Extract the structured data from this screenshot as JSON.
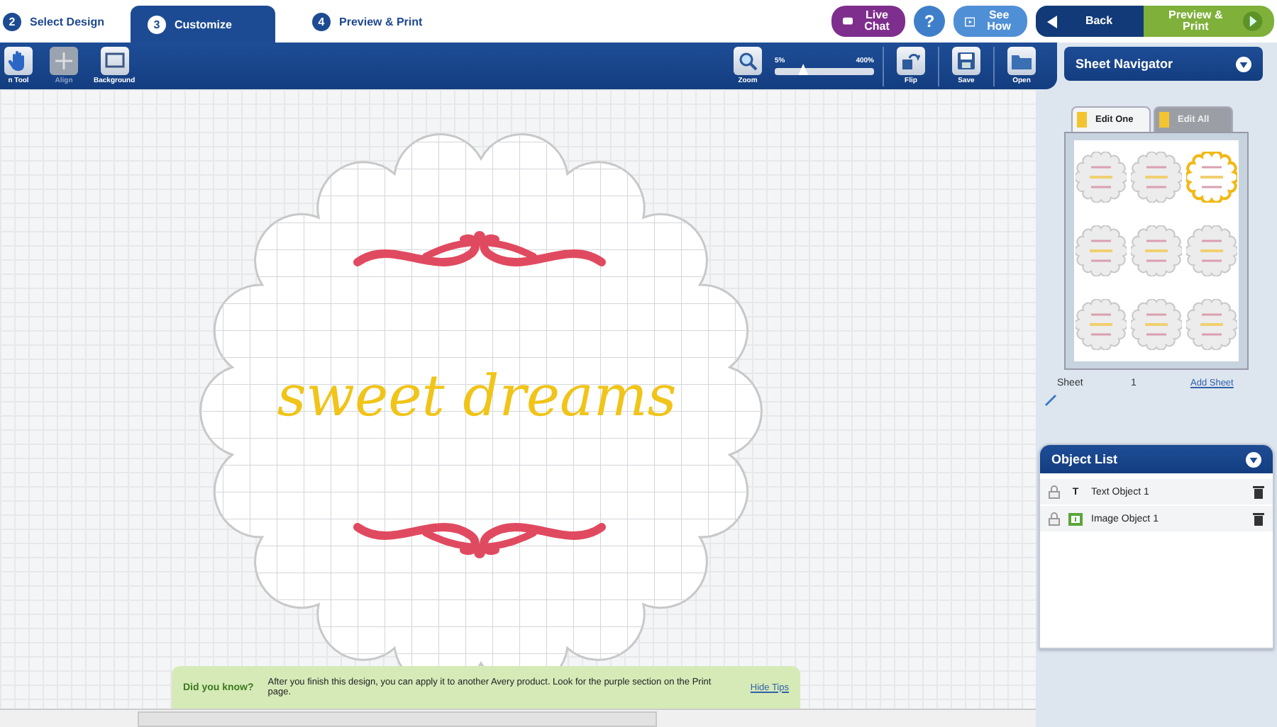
{
  "steps": [
    {
      "number": "2",
      "label": "Select Design",
      "selected": false
    },
    {
      "number": "3",
      "label": "Customize",
      "selected": true
    },
    {
      "number": "4",
      "label": "Preview & Print",
      "selected": false
    }
  ],
  "header_buttons": [
    {
      "kind": "chat",
      "label": "Live Chat"
    },
    {
      "kind": "help",
      "label": "?"
    },
    {
      "kind": "video",
      "label": "See How"
    },
    {
      "kind": "back",
      "label": "Back"
    },
    {
      "kind": "next",
      "label": "Preview & Print"
    }
  ],
  "tools": [
    {
      "kind": "hand",
      "label": "n Tool",
      "disabled": false
    },
    {
      "kind": "align",
      "label": "Align",
      "disabled": true
    },
    {
      "kind": "background",
      "label": "Background",
      "disabled": false
    }
  ],
  "zoom": {
    "label": "Zoom",
    "min": "5%",
    "max": "400%",
    "level": 0.28
  },
  "actions": [
    {
      "kind": "flip",
      "label": "Flip"
    },
    {
      "kind": "save",
      "label": "Save"
    },
    {
      "kind": "open",
      "label": "Open"
    }
  ],
  "design": {
    "text": "sweet dreams"
  },
  "tip": {
    "title": "Did you know?",
    "text": "After you finish this design, you can apply it to another Avery product.  Look for the purple section on the Print page.",
    "link": "Hide Tips"
  },
  "sheet_navigator": {
    "title": "Sheet Navigator",
    "tabs": [
      {
        "label": "Edit One",
        "selected": true
      },
      {
        "label": "Edit All",
        "selected": false
      }
    ],
    "thumbnails": [
      {
        "selected": false
      },
      {
        "selected": false
      },
      {
        "selected": true
      },
      {
        "selected": false
      },
      {
        "selected": false
      },
      {
        "selected": false
      },
      {
        "selected": false
      },
      {
        "selected": false
      },
      {
        "selected": false
      }
    ],
    "sheet_label": "Sheet",
    "sheet_number": "1",
    "add_link": "Add Sheet"
  },
  "object_list": {
    "title": "Object List",
    "items": [
      {
        "kind": "text",
        "type_mark": "T",
        "label": "Text Object 1"
      },
      {
        "kind": "image",
        "label": "Image Object 1"
      }
    ]
  }
}
